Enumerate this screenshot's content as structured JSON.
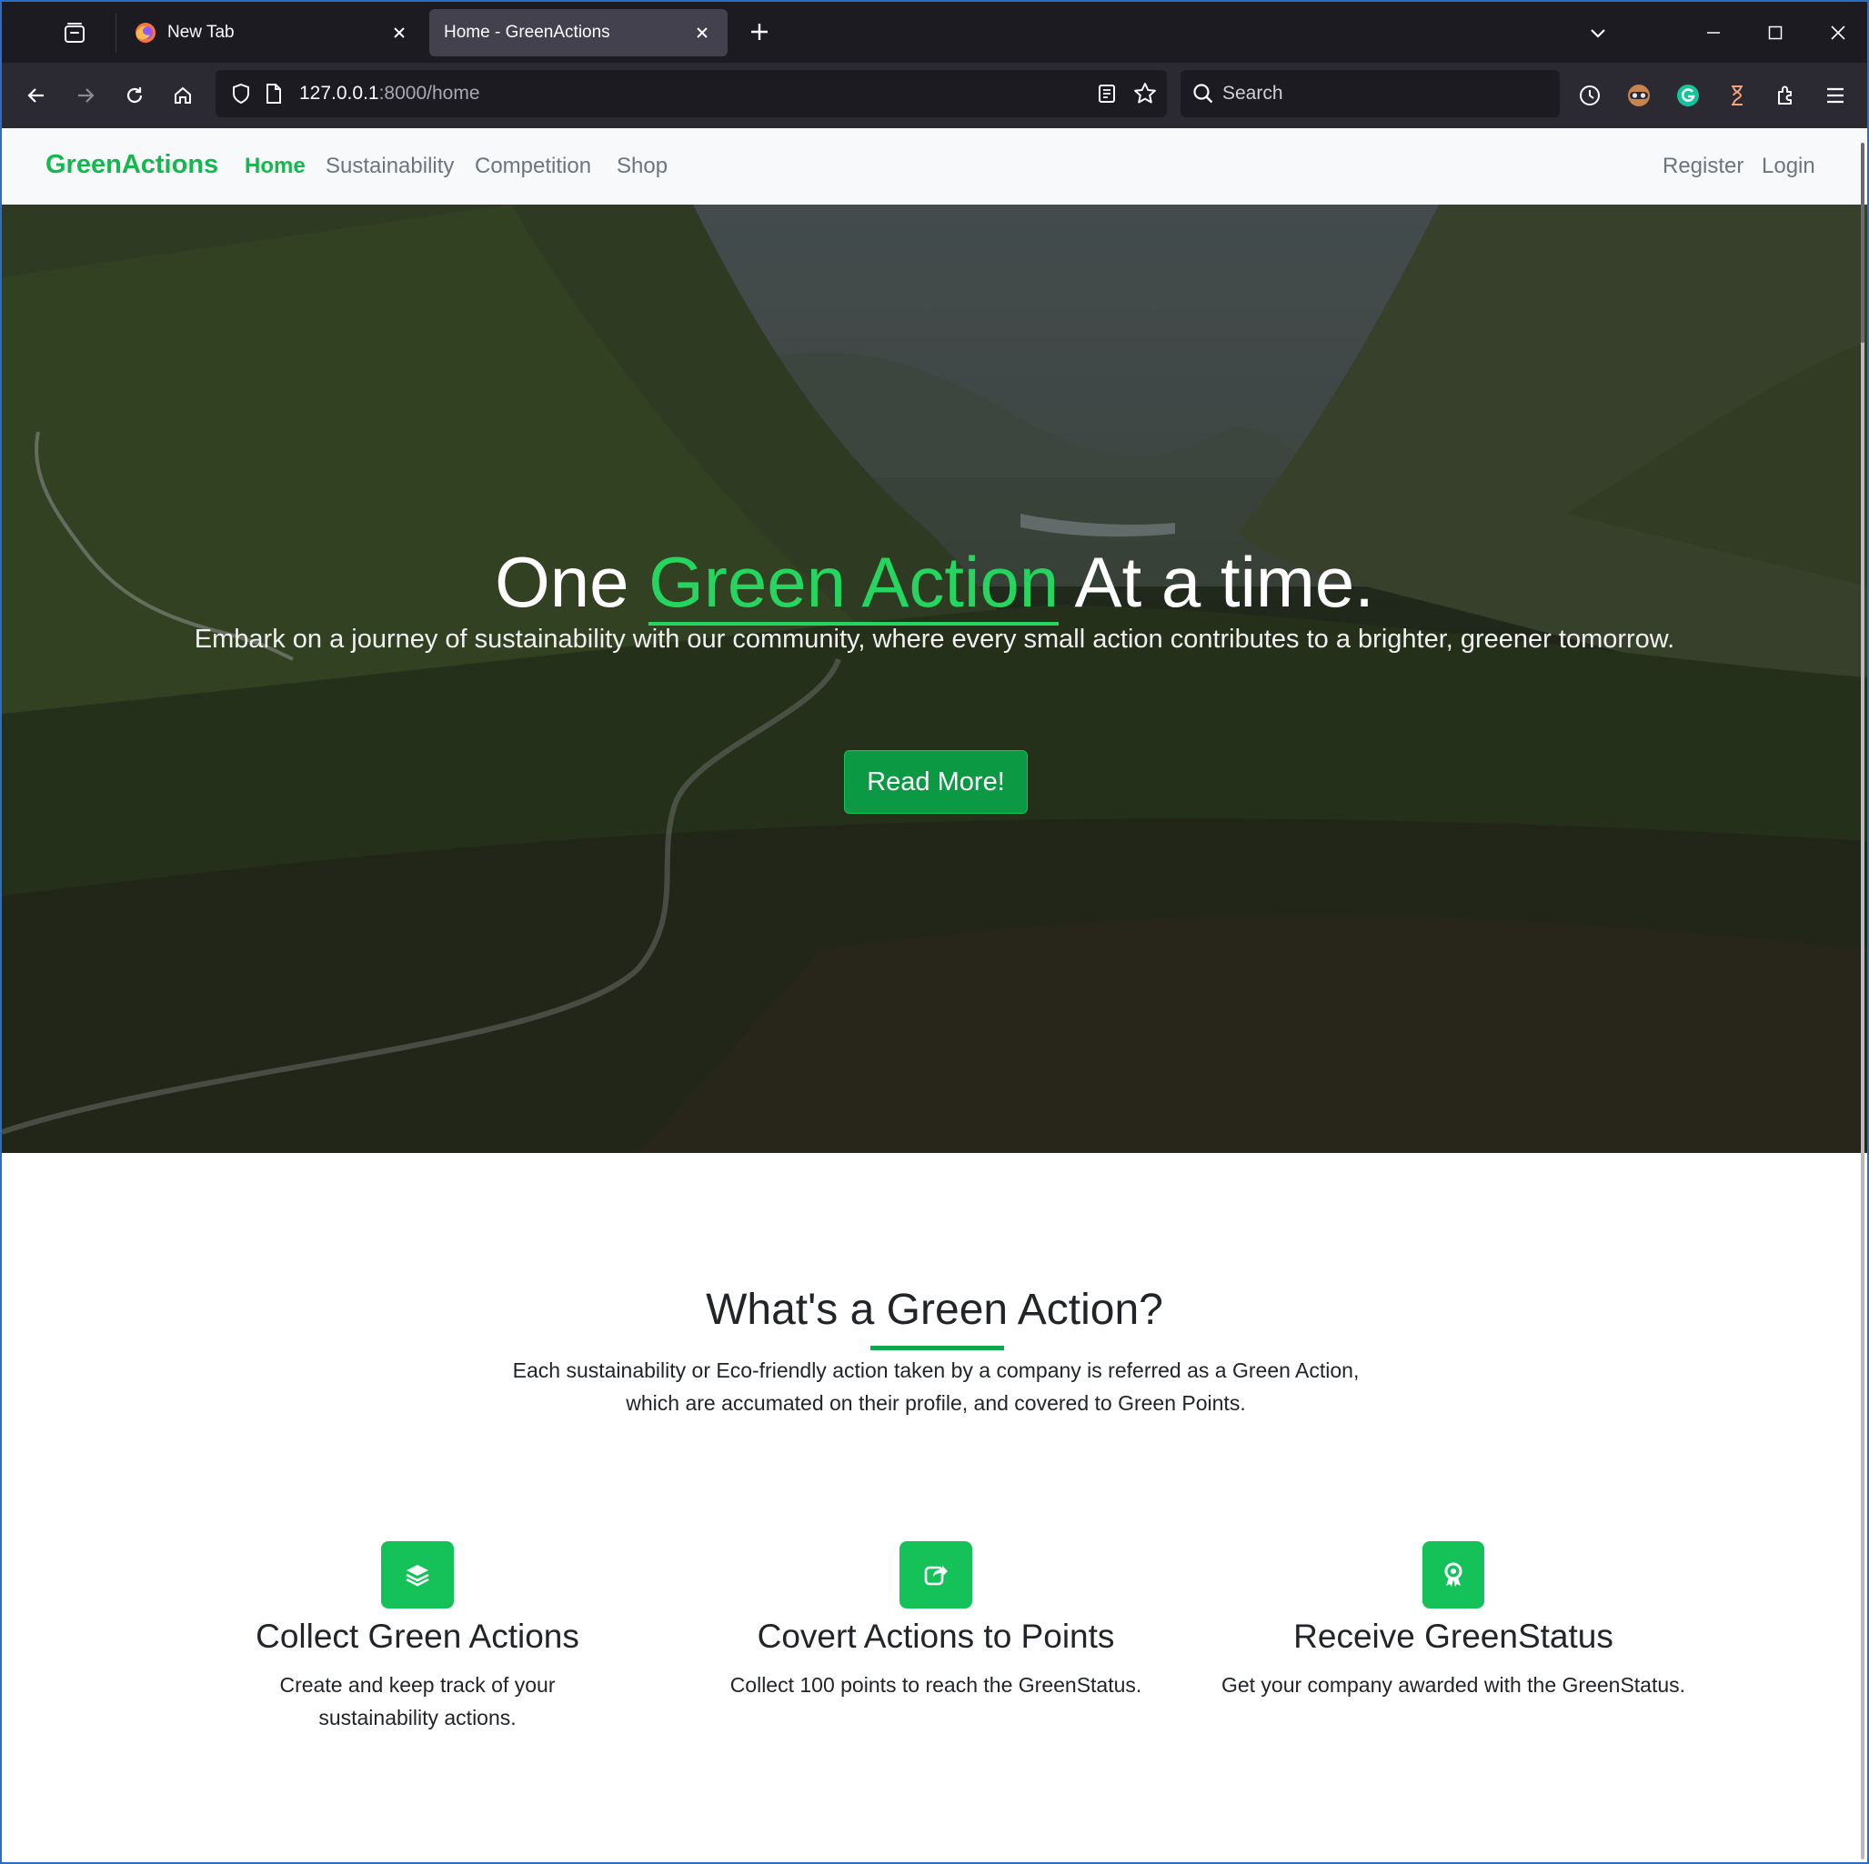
{
  "browser": {
    "tabs": [
      {
        "title": "New Tab",
        "active": false
      },
      {
        "title": "Home - GreenActions",
        "active": true
      }
    ],
    "url_host": "127.0.0.1",
    "url_rest": ":8000/home",
    "search_placeholder": "Search"
  },
  "navbar": {
    "brand": "GreenActions",
    "links": [
      "Home",
      "Sustainability",
      "Competition",
      "Shop"
    ],
    "active_link": "Home",
    "right_links": [
      "Register",
      "Login"
    ]
  },
  "hero": {
    "title_start": "One ",
    "title_accent": "Green Action",
    "title_end": " At a time.",
    "subtitle": "Embark on a journey of sustainability with our community, where every small action contributes to a brighter, greener tomorrow.",
    "cta": "Read More!"
  },
  "about": {
    "title": "What's a Green Action?",
    "description_line1": "Each sustainability or Eco-friendly action taken by a company is referred as a Green Action,",
    "description_line2": "which are accumated on their profile, and covered to Green Points."
  },
  "features": [
    {
      "icon": "layers-icon",
      "title": "Collect Green Actions",
      "text": "Create and keep track of your sustainability actions."
    },
    {
      "icon": "share-icon",
      "title": "Covert Actions to Points",
      "text": "Collect 100 points to reach the GreenStatus."
    },
    {
      "icon": "award-icon",
      "title": "Receive GreenStatus",
      "text": "Get your company awarded with the GreenStatus."
    }
  ],
  "colors": {
    "brand_green": "#14b84f",
    "accent_green": "#25d55f",
    "button_green": "#0b9a43",
    "icon_bg": "#14c259"
  }
}
